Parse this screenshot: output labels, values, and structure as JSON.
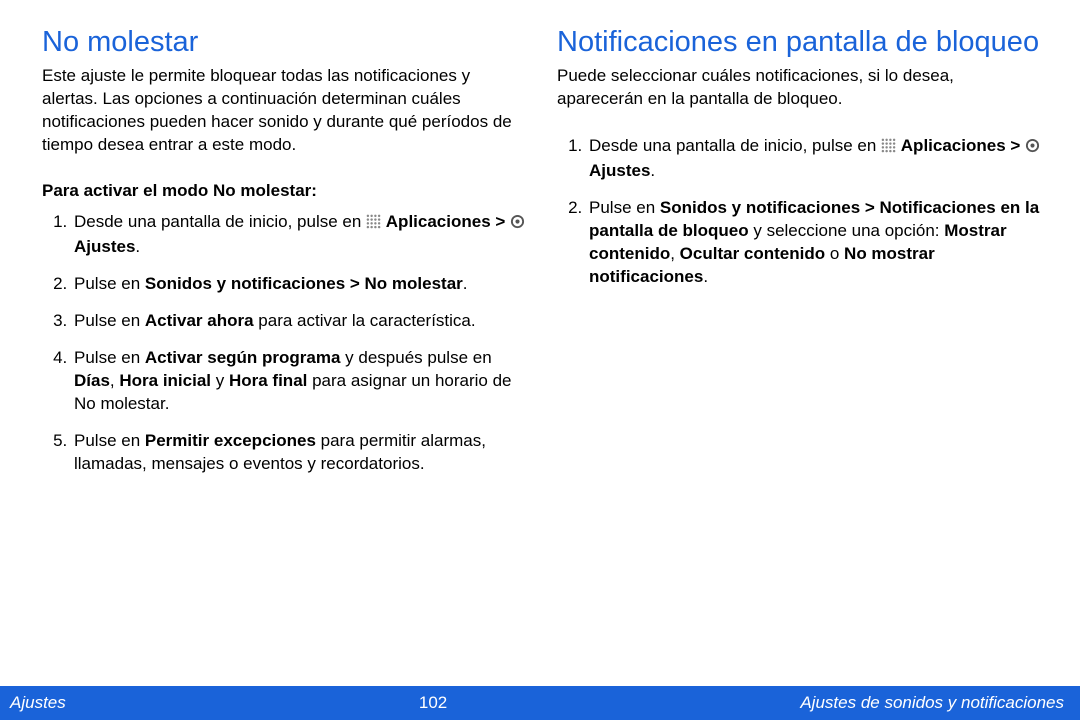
{
  "left": {
    "title": "No molestar",
    "intro": "Este ajuste le permite bloquear todas las notificaciones y alertas. Las opciones a continuación determinan cuáles notificaciones pueden hacer sonido y durante qué períodos de tiempo desea entrar a este modo.",
    "subhead": "Para activar el modo No molestar:",
    "steps": {
      "s1a": "Desde una pantalla de inicio, pulse en ",
      "s1b": "Aplicaciones > ",
      "s1c": " Ajustes",
      "s1d": ".",
      "s2a": "Pulse en ",
      "s2b": "Sonidos y notificaciones > No molestar",
      "s2c": ".",
      "s3a": "Pulse en ",
      "s3b": "Activar ahora",
      "s3c": " para activar la característica.",
      "s4a": "Pulse en ",
      "s4b": "Activar según programa",
      "s4c": " y después pulse en ",
      "s4d": "Días",
      "s4e": ", ",
      "s4f": "Hora inicial",
      "s4g": " y ",
      "s4h": "Hora final",
      "s4i": " para asignar un horario de No molestar.",
      "s5a": "Pulse en ",
      "s5b": "Permitir excepciones",
      "s5c": " para permitir alarmas, llamadas, mensajes o eventos y recordatorios."
    }
  },
  "right": {
    "title": "Notificaciones en pantalla de bloqueo",
    "intro": "Puede seleccionar cuáles notificaciones, si lo desea, aparecerán en la pantalla de bloqueo.",
    "steps": {
      "s1a": "Desde una pantalla de inicio, pulse en ",
      "s1b": "Aplicaciones > ",
      "s1c": " Ajustes",
      "s1d": ".",
      "s2a": "Pulse en ",
      "s2b": "Sonidos y notificaciones > Notificaciones en la pantalla de bloqueo",
      "s2c": " y seleccione una opción: ",
      "s2d": "Mostrar contenido",
      "s2e": ", ",
      "s2f": "Ocultar contenido",
      "s2g": " o ",
      "s2h": "No mostrar notificaciones",
      "s2i": "."
    }
  },
  "footer": {
    "left": "Ajustes",
    "page": "102",
    "right": "Ajustes de sonidos y notificaciones"
  }
}
